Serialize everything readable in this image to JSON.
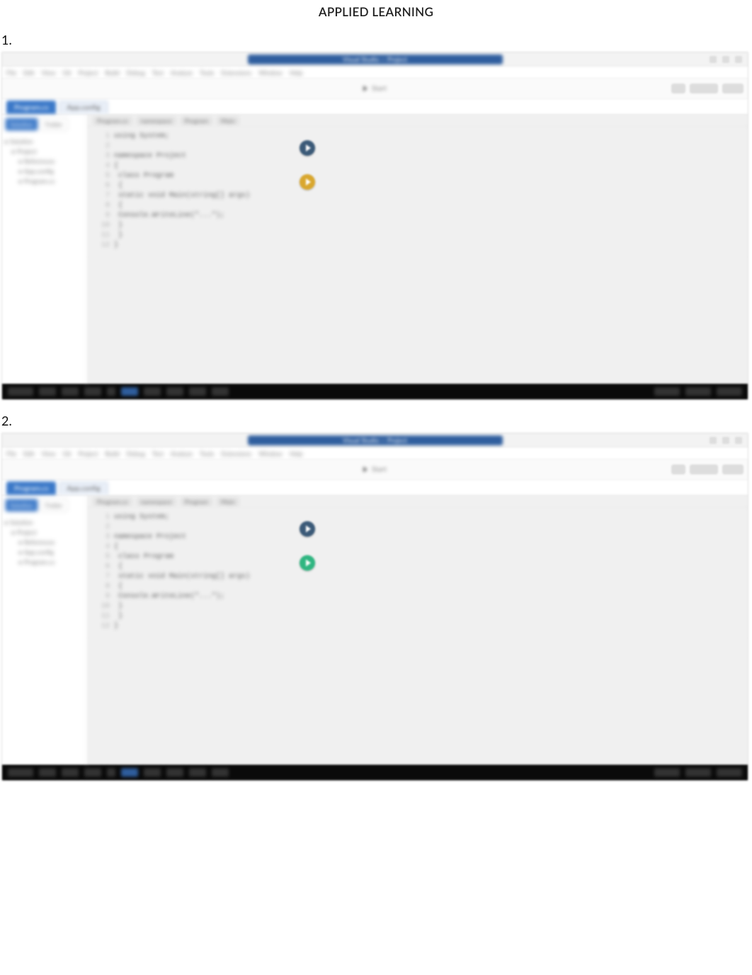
{
  "heading": "APPLIED LEARNING",
  "items": [
    "1.",
    "2."
  ],
  "shot_common": {
    "title_pill": "Visual Studio — Project",
    "menubar": [
      "File",
      "Edit",
      "View",
      "Git",
      "Project",
      "Build",
      "Debug",
      "Test",
      "Analyze",
      "Tools",
      "Extensions",
      "Window",
      "Help"
    ],
    "toolbar_center": "Start",
    "side_tab_active": "Solution",
    "side_tab_other": "Folder",
    "tree": [
      "Solution",
      "Project",
      "References",
      "App.config",
      "Program.cs"
    ],
    "path_crumbs": [
      "Program.cs",
      "namespace",
      "Program",
      "Main"
    ],
    "file_tab_active": "Program.cs",
    "file_tab_other": "App.config",
    "code_lines": [
      "using System;",
      "",
      "namespace Project",
      "{",
      "    class Program",
      "    {",
      "        static void Main(string[] args)",
      "        {",
      "            Console.WriteLine(\"...\");",
      "        }",
      "    }",
      "}"
    ],
    "status_right": [
      "Ln 1",
      "Col 1",
      "INS"
    ]
  },
  "shot1": {
    "run_dot2_color": "amber"
  },
  "shot2": {
    "run_dot2_color": "green"
  }
}
